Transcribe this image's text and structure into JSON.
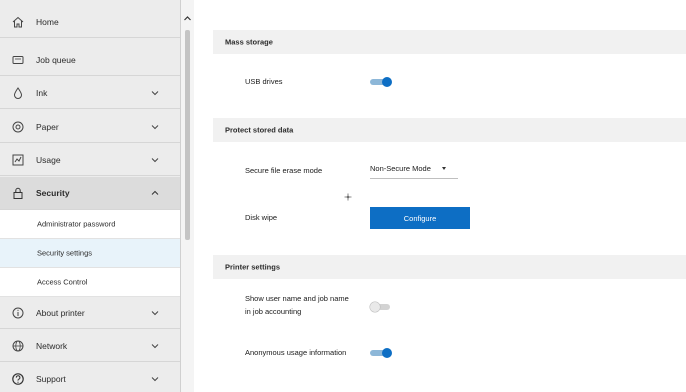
{
  "sidebar": {
    "items": [
      {
        "label": "Home",
        "icon": "home-icon"
      },
      {
        "label": "Job queue",
        "icon": "job-queue-icon"
      },
      {
        "label": "Ink",
        "icon": "ink-drop-icon"
      },
      {
        "label": "Paper",
        "icon": "paper-roll-icon"
      },
      {
        "label": "Usage",
        "icon": "usage-icon"
      },
      {
        "label": "Security",
        "icon": "lock-icon"
      },
      {
        "label": "About printer",
        "icon": "info-icon"
      },
      {
        "label": "Network",
        "icon": "globe-icon"
      },
      {
        "label": "Support",
        "icon": "help-icon"
      }
    ],
    "security_subitems": [
      {
        "label": "Administrator password"
      },
      {
        "label": "Security settings"
      },
      {
        "label": "Access Control"
      }
    ]
  },
  "main": {
    "mass_storage": {
      "title": "Mass storage",
      "usb_drives_label": "USB drives",
      "usb_drives_enabled": true
    },
    "protect_stored_data": {
      "title": "Protect stored data",
      "secure_erase_label": "Secure file erase mode",
      "secure_erase_value": "Non-Secure Mode",
      "disk_wipe_label": "Disk wipe",
      "configure_label": "Configure"
    },
    "printer_settings": {
      "title": "Printer settings",
      "show_user_label_line1": "Show user name and job name",
      "show_user_label_line2": "in job accounting",
      "show_user_enabled": false,
      "anonymous_usage_label": "Anonymous usage information",
      "anonymous_usage_enabled": true
    }
  },
  "colors": {
    "accent": "#0d6ec4",
    "sidebar_bg": "#ececec",
    "selected_subitem_bg": "#e8f3fa",
    "section_header_bg": "#f1f1f1"
  }
}
